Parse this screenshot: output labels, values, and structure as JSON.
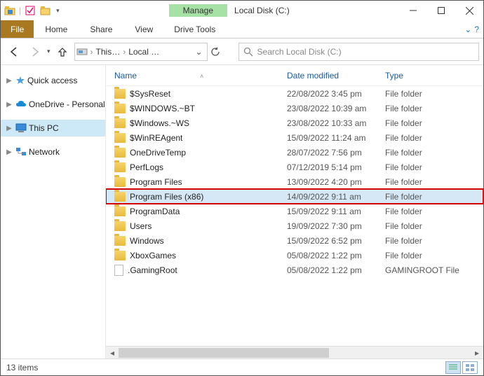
{
  "titlebar": {
    "context_label": "Manage",
    "title": "Local Disk (C:)"
  },
  "ribbon": {
    "file_tab": "File",
    "tabs": [
      "Home",
      "Share",
      "View"
    ],
    "context_tab": "Drive Tools"
  },
  "nav": {
    "breadcrumb": [
      "This…",
      "Local …"
    ],
    "search_placeholder": "Search Local Disk (C:)"
  },
  "sidebar": {
    "items": [
      {
        "label": "Quick access",
        "icon": "star"
      },
      {
        "label": "OneDrive - Personal",
        "icon": "cloud"
      },
      {
        "label": "This PC",
        "icon": "pc",
        "selected": true
      },
      {
        "label": "Network",
        "icon": "network"
      }
    ]
  },
  "columns": {
    "name": "Name",
    "date": "Date modified",
    "type": "Type"
  },
  "rows": [
    {
      "name": "$SysReset",
      "date": "22/08/2022 3:45 pm",
      "type": "File folder",
      "kind": "folder"
    },
    {
      "name": "$WINDOWS.~BT",
      "date": "23/08/2022 10:39 am",
      "type": "File folder",
      "kind": "folder"
    },
    {
      "name": "$Windows.~WS",
      "date": "23/08/2022 10:33 am",
      "type": "File folder",
      "kind": "folder"
    },
    {
      "name": "$WinREAgent",
      "date": "15/09/2022 11:24 am",
      "type": "File folder",
      "kind": "folder"
    },
    {
      "name": "OneDriveTemp",
      "date": "28/07/2022 7:56 pm",
      "type": "File folder",
      "kind": "folder"
    },
    {
      "name": "PerfLogs",
      "date": "07/12/2019 5:14 pm",
      "type": "File folder",
      "kind": "folder"
    },
    {
      "name": "Program Files",
      "date": "13/09/2022 4:20 pm",
      "type": "File folder",
      "kind": "folder"
    },
    {
      "name": "Program Files (x86)",
      "date": "14/09/2022 9:11 am",
      "type": "File folder",
      "kind": "folder",
      "highlight": true
    },
    {
      "name": "ProgramData",
      "date": "15/09/2022 9:11 am",
      "type": "File folder",
      "kind": "folder"
    },
    {
      "name": "Users",
      "date": "19/09/2022 7:30 pm",
      "type": "File folder",
      "kind": "folder"
    },
    {
      "name": "Windows",
      "date": "15/09/2022 6:52 pm",
      "type": "File folder",
      "kind": "folder"
    },
    {
      "name": "XboxGames",
      "date": "05/08/2022 1:22 pm",
      "type": "File folder",
      "kind": "folder"
    },
    {
      "name": ".GamingRoot",
      "date": "05/08/2022 1:22 pm",
      "type": "GAMINGROOT File",
      "kind": "file"
    }
  ],
  "status": {
    "text": "13 items"
  }
}
